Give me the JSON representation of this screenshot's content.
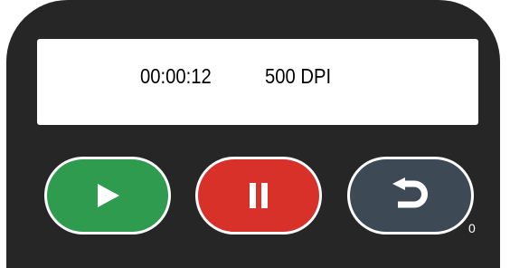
{
  "display": {
    "timer": "00:00:12",
    "dpi": "500 DPI"
  },
  "controls": {
    "play": {
      "icon": "play-icon",
      "color": "#2f9b4f"
    },
    "pause": {
      "icon": "pause-icon",
      "color": "#d7312a"
    },
    "back": {
      "icon": "undo-arrow-icon",
      "color": "#3d4a55"
    }
  },
  "counter": "0"
}
